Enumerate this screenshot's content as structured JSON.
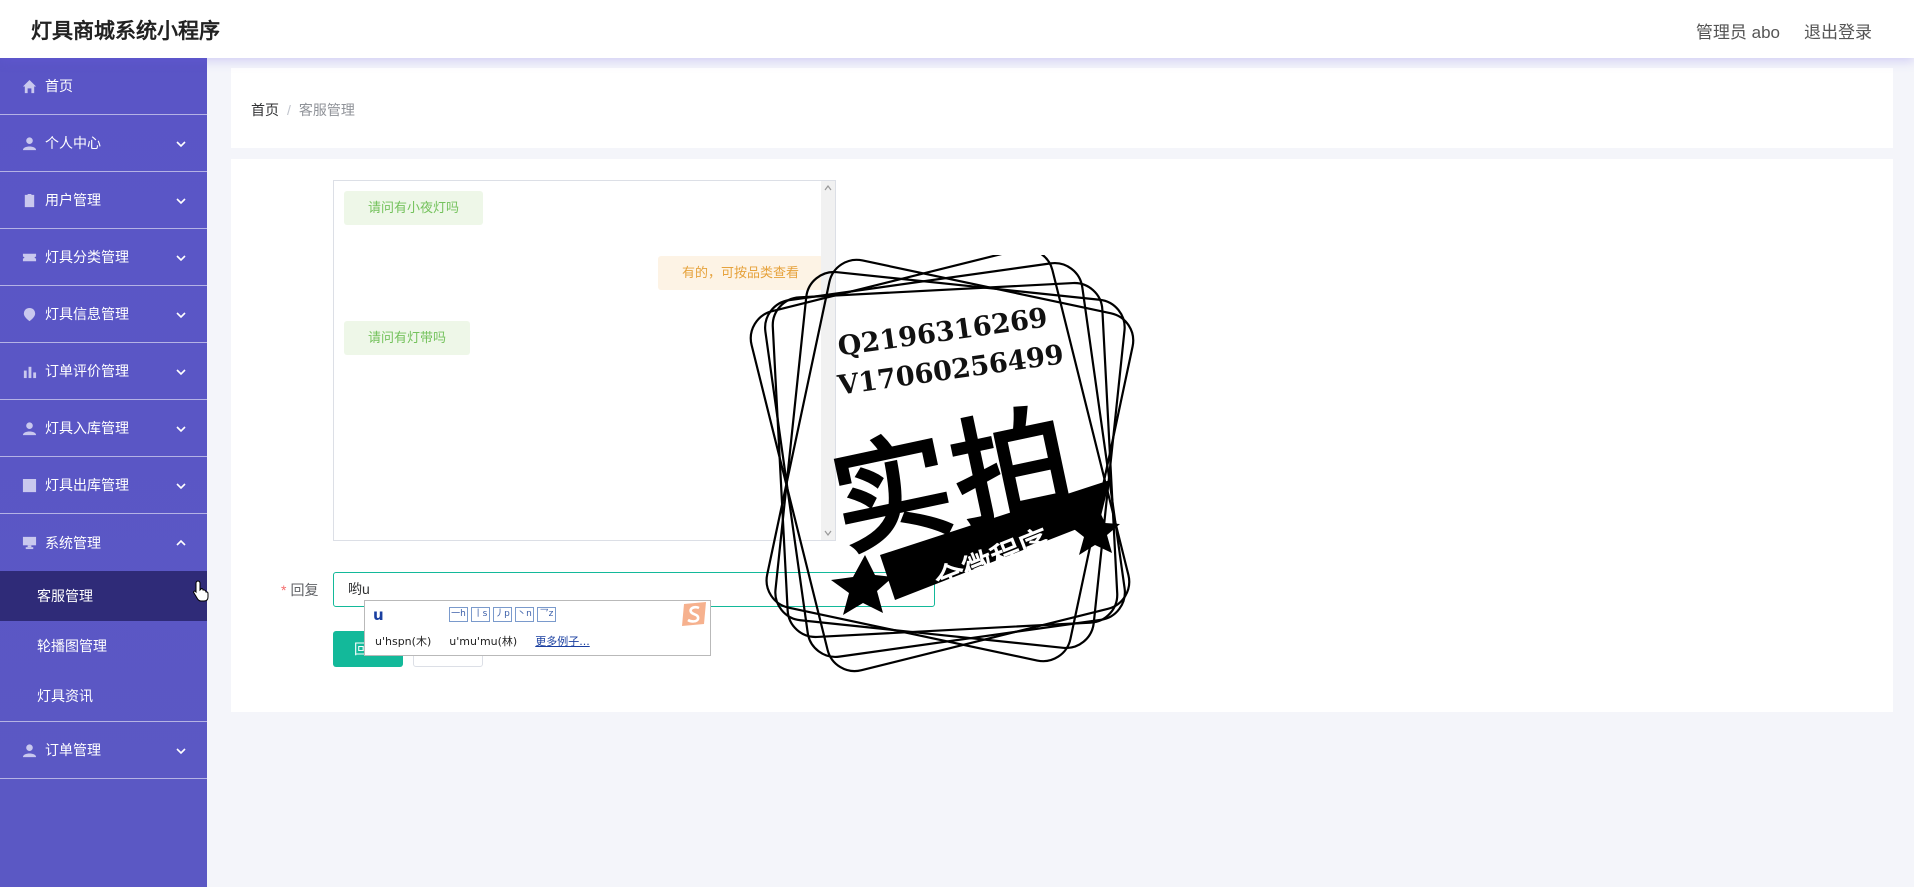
{
  "header": {
    "title": "灯具商城系统小程序",
    "user_label": "管理员 abo",
    "logout_label": "退出登录"
  },
  "sidebar": {
    "items": [
      {
        "label": "首页",
        "icon": "home-icon",
        "has_arrow": false
      },
      {
        "label": "个人中心",
        "icon": "user-icon",
        "has_arrow": true
      },
      {
        "label": "用户管理",
        "icon": "clipboard-icon",
        "has_arrow": true
      },
      {
        "label": "灯具分类管理",
        "icon": "ticket-icon",
        "has_arrow": true
      },
      {
        "label": "灯具信息管理",
        "icon": "location-icon",
        "has_arrow": true
      },
      {
        "label": "订单评价管理",
        "icon": "bar-chart-icon",
        "has_arrow": true
      },
      {
        "label": "灯具入库管理",
        "icon": "user-icon",
        "has_arrow": true
      },
      {
        "label": "灯具出库管理",
        "icon": "chart-box-icon",
        "has_arrow": true
      },
      {
        "label": "系统管理",
        "icon": "monitor-icon",
        "has_arrow": true,
        "expanded": true
      },
      {
        "label": "订单管理",
        "icon": "user-icon",
        "has_arrow": true
      }
    ],
    "system_submenu": [
      {
        "label": "客服管理",
        "active": true
      },
      {
        "label": "轮播图管理",
        "active": false
      },
      {
        "label": "灯具资讯",
        "active": false
      }
    ]
  },
  "breadcrumb": {
    "home": "首页",
    "separator": "/",
    "current": "客服管理"
  },
  "chat": {
    "messages": [
      {
        "side": "left",
        "text": "请问有小夜灯吗"
      },
      {
        "side": "right",
        "text": "有的，可按品类查看"
      },
      {
        "side": "left",
        "text": "请问有灯带吗"
      }
    ]
  },
  "reply": {
    "required_mark": "*",
    "label": "回复",
    "value": "哟u"
  },
  "buttons": {
    "submit_label": "回复",
    "reset_label": "重置"
  },
  "ime": {
    "composition": "u",
    "tones": [
      "一h",
      "丨s",
      "丿p",
      "丶n",
      "乛z"
    ],
    "candidates": [
      "u'hspn(木)",
      "u'mu'mu(林)"
    ],
    "more_label": "更多例子..."
  },
  "watermark": {
    "line1": "Q2196316269",
    "line2": "V17060256499",
    "big": "实拍",
    "banner": "全微程序"
  },
  "colors": {
    "sidebar_bg": "#5a55c6",
    "sidebar_active": "#2f2b78",
    "primary": "#13b99a"
  }
}
